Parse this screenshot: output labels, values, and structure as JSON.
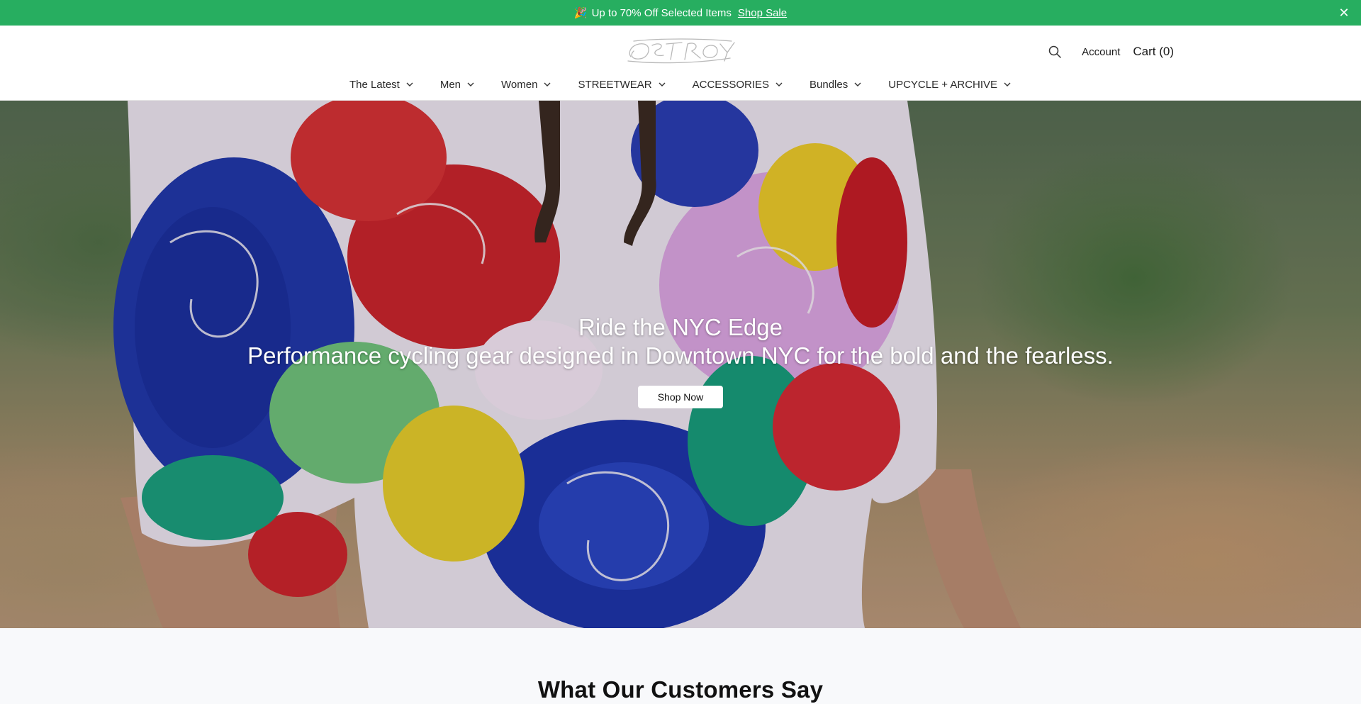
{
  "announcement": {
    "emoji": "🎉",
    "text": "Up to 70% Off Selected Items",
    "link_label": "Shop Sale",
    "close_label": "✕",
    "bg_color": "#27ae60"
  },
  "header": {
    "logo_alt": "OSTROY",
    "search_icon": "search-icon",
    "account_label": "Account",
    "cart_label": "Cart (0)"
  },
  "nav": {
    "items": [
      {
        "label": "The Latest"
      },
      {
        "label": "Men"
      },
      {
        "label": "Women"
      },
      {
        "label": "STREETWEAR"
      },
      {
        "label": "ACCESSORIES"
      },
      {
        "label": "Bundles"
      },
      {
        "label": "UPCYCLE + ARCHIVE"
      }
    ]
  },
  "hero": {
    "title": "Ride the NYC Edge",
    "subtitle": "Performance cycling gear designed in Downtown NYC for the bold and the fearless.",
    "cta_label": "Shop Now"
  },
  "testimonials": {
    "heading": "What Our Customers Say"
  }
}
